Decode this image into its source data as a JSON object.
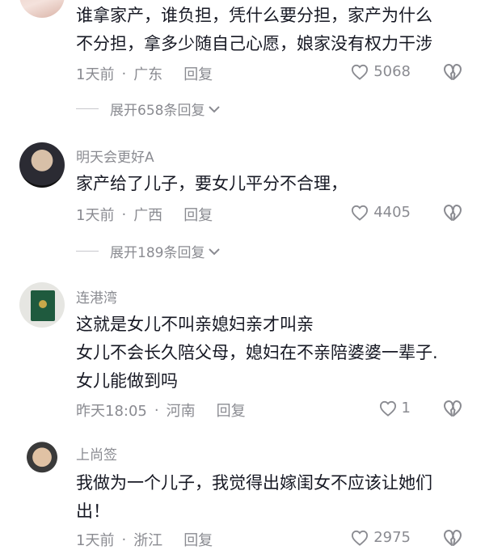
{
  "comments": [
    {
      "username": "",
      "lines": [
        "谁拿家产，谁负担，凭什么要分担，家产为什么",
        "不分担，拿多少随自己心愿，娘家没有权力干涉"
      ],
      "time": "1天前",
      "location": "广东",
      "reply_label": "回复",
      "likes": "5068",
      "expand_label": "展开658条回复"
    },
    {
      "username": "明天会更好A",
      "lines": [
        "家产给了儿子，要女儿平分不合理，"
      ],
      "time": "1天前",
      "location": "广西",
      "reply_label": "回复",
      "likes": "4405",
      "expand_label": "展开189条回复"
    },
    {
      "username": "连港湾",
      "lines": [
        "这就是女儿不叫亲媳妇亲才叫亲",
        "女儿不会长久陪父母，媳妇在不亲陪婆婆一辈子.",
        "女儿能做到吗"
      ],
      "time": "昨天18:05",
      "location": "河南",
      "reply_label": "回复",
      "likes": "1"
    },
    {
      "username": "上尚签",
      "lines": [
        "我做为一个儿子，我觉得出嫁闺女不应该让她们",
        "出！"
      ],
      "time": "1天前",
      "location": "浙江",
      "reply_label": "回复",
      "likes": "2975"
    }
  ],
  "separator": "·",
  "icons": {
    "like": "heart-outline-icon",
    "dislike": "broken-heart-icon",
    "expand": "chevron-down-icon"
  },
  "colors": {
    "text": "#161823",
    "secondary": "#8a8b91"
  }
}
